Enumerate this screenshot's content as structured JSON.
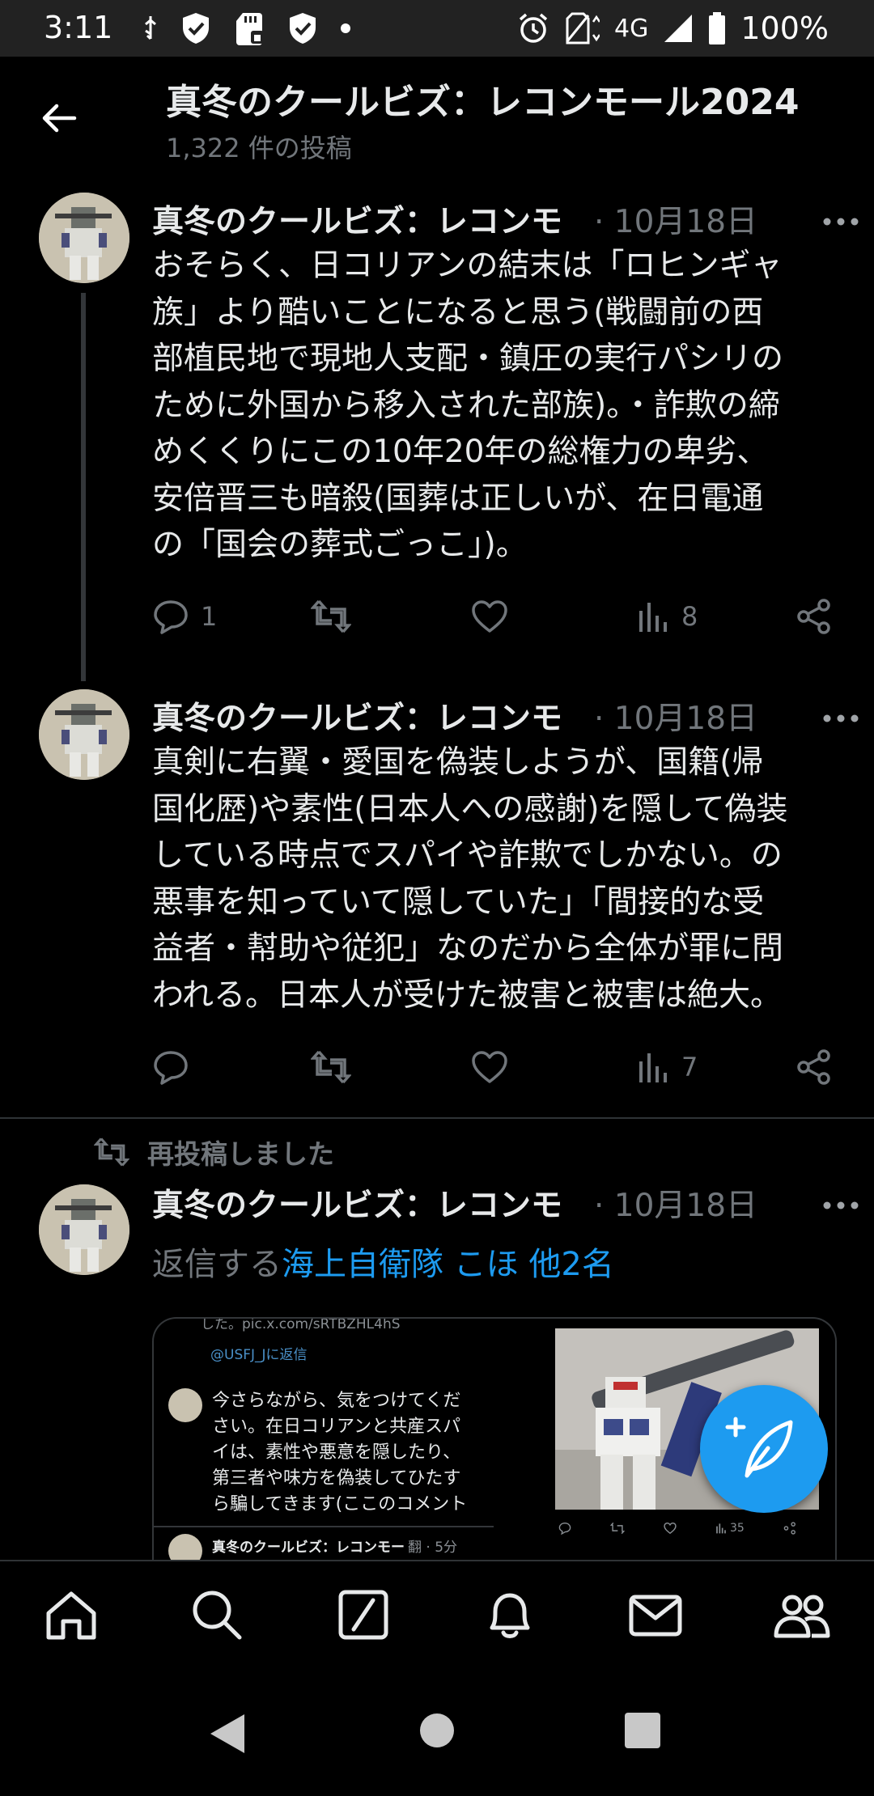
{
  "status": {
    "time": "3:11",
    "network": "4G",
    "battery": "100%"
  },
  "header": {
    "title": "真冬のクールビズ：レコンモール2024",
    "post_count": "1,322 件の投稿"
  },
  "posts": [
    {
      "author": "真冬のクールビズ：レコンモ",
      "date": "· 10月18日",
      "lines": [
        "おそらく、日コリアンの結末は「ロヒンギャ",
        "族」より酷いことになると思う(戦闘前の西",
        "部植民地で現地人支配・鎮圧の実行パシリの",
        "ために外国から移入された部族)。・詐欺の締",
        "めくくりにこの10年20年の総権力の卑劣、",
        "安倍晋三も暗殺(国葬は正しいが、在日電通",
        "の「国会の葬式ごっこ」)。"
      ],
      "replies": "1",
      "reposts": "",
      "likes": "",
      "views": "8"
    },
    {
      "author": "真冬のクールビズ：レコンモ",
      "date": "· 10月18日",
      "lines": [
        "真剣に右翼・愛国を偽装しようが、国籍(帰",
        "国化歴)や素性(日本人への感謝)を隠して偽装",
        "している時点でスパイや詐欺でしかない。の",
        "悪事を知っていて隠していた」「間接的な受",
        "益者・幇助や従犯」なのだから全体が罪に問",
        "われる。日本人が受けた被害と被害は絶大。"
      ],
      "replies": "",
      "reposts": "",
      "likes": "",
      "views": "7"
    },
    {
      "repost_label": "再投稿しました",
      "author": "真冬のクールビズ：レコンモ",
      "date": "· 10月18日",
      "reply_prefix": "返信する",
      "reply_mentions": "海上自衛隊 こほ 他2名"
    }
  ],
  "embedded_screenshot": {
    "url_text": "した。pic.x.com/sRTBZHL4hS",
    "reply_to": "@USFJ_Jに返信",
    "lines": [
      "今さらながら、気をつけてくだ",
      "さい。在日コリアンと共産スパ",
      "イは、素性や悪意を隠したり、",
      "第三者や味方を偽装してひたす",
      "ら騙してきます(ここのコメント"
    ],
    "next_author": "真冬のクールビズ：レコンモー",
    "next_meta": "翻 · 5分",
    "image_views": "35"
  },
  "colors": {
    "background": "#000000",
    "text": "#e7e9ea",
    "muted": "#71767b",
    "accent": "#1d9bf0",
    "divider": "#2f3336"
  },
  "icons": {
    "compose": "feather-plus-icon",
    "tabs": [
      "home-icon",
      "search-icon",
      "grok-icon",
      "bell-icon",
      "mail-icon",
      "communities-icon"
    ]
  }
}
